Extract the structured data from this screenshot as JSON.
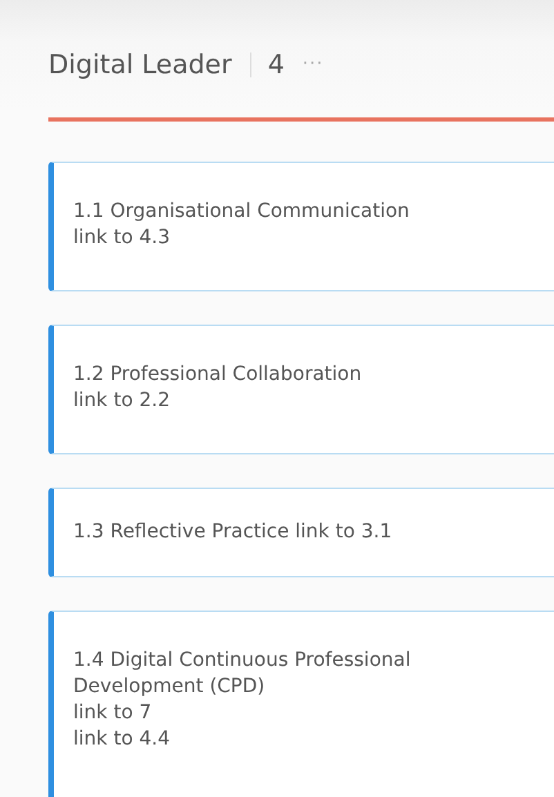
{
  "column": {
    "title": "Digital Leader",
    "count": "4",
    "more": "···"
  },
  "cards": [
    {
      "lines": [
        "1.1 Organisational Communication",
        "link to 4.3"
      ]
    },
    {
      "lines": [
        "1.2 Professional Collaboration",
        "link to 2.2"
      ]
    },
    {
      "lines": [
        "1.3 Reflective Practice link to 3.1"
      ]
    },
    {
      "lines": [
        "1.4 Digital Continuous Professional",
        "Development (CPD)",
        "link to 7",
        "link to 4.4"
      ]
    }
  ]
}
